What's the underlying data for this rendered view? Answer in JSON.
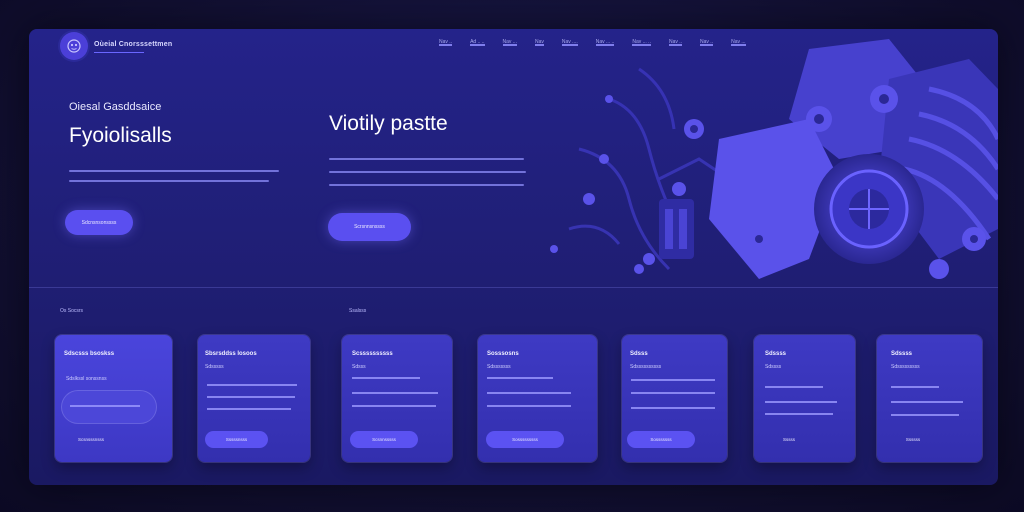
{
  "header": {
    "brand": "Oùeial Cnorsssettmen",
    "logo_icon": "robot-icon",
    "nav": [
      "Nav ..",
      "Ad .. ..",
      "Nav ...",
      "Nav",
      "Nav ....",
      "Nav ... ..",
      "Nav ... ..",
      "Nav ..",
      "Nav ..",
      "Nav ..."
    ]
  },
  "hero": {
    "eyebrow": "Oiesal Gasddsaice",
    "title": "Fyoiolisalls",
    "title_right": "Viotily pastte",
    "button_left": "Sdcnsnsonssss",
    "button_right": "Scrsnnsnssss",
    "art_icon": "circuit-gear-art"
  },
  "sections": {
    "label_left": "Os Socsrs",
    "label_mid": "Ssalsss"
  },
  "cards": [
    {
      "title": "Sdscsss bsoskss",
      "sub": "Sdslkssl sonssnss",
      "button": "Scsnsssnsss"
    },
    {
      "title": "Sbsrsddss losoos",
      "sub": "Sdsssss",
      "button": "Sssssnsss"
    },
    {
      "title": "Scssssssssss",
      "sub": "Sdsss",
      "button": "Scsnnsssss"
    },
    {
      "title": "Sosssosns",
      "sub": "Sdsssssss",
      "button": "Sosssssssss"
    },
    {
      "title": "Sdsss",
      "sub": "Sdssssssssss",
      "button": "Sosssssss"
    },
    {
      "title": "Sdssss",
      "sub": "Sdssss",
      "button": "Sssss"
    },
    {
      "title": "Sdssss",
      "sub": "Sdsssssssss",
      "button": "Ssssss"
    }
  ],
  "colors": {
    "background": "#121033",
    "panel": "#24238a",
    "accent": "#5a4ff0",
    "card": "#3e3ac4"
  }
}
